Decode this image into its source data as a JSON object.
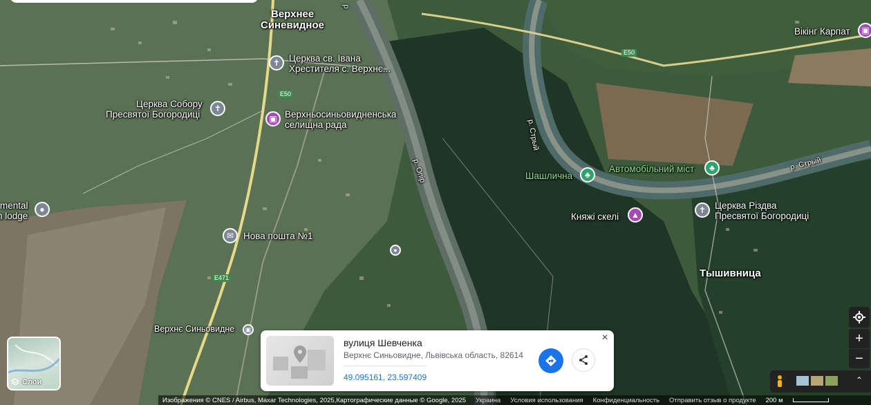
{
  "labels": {
    "town1_line1": "Верхнее",
    "town1_line2": "Синевидное",
    "church_ivan_line1": "Церква св. Івана",
    "church_ivan_line2": "Хрестителя с. Верхнє...",
    "church_sobor_line1": "Церква Собору",
    "church_sobor_line2": "Пресвятої Богородиці",
    "council_line1": "Верхньосиньовидненська",
    "council_line2": "селищна рада",
    "mental_line1": "mental",
    "mental_line2": "n lodge",
    "nova_poshta": "Нова пошта №1",
    "station": "Верхнє Синьовидне",
    "shashlychna": "Шашлична",
    "auto_bridge": "Автомобільний міст",
    "kniazhi": "Княжі скелі",
    "church_rizdva_line1": "Церква Різдва",
    "church_rizdva_line2": "Пресвятої Богородиці",
    "tyshivnytsia": "Тышивница",
    "viking": "Вікінг Карпат",
    "river_opir": "р. Опір",
    "river_stryi1": "р. Стрый",
    "river_stryi2": "р. Стрый",
    "river_top": "р"
  },
  "roads": {
    "e50_a": "E50",
    "e50_b": "E50",
    "e471": "E471"
  },
  "card": {
    "title": "вулиця Шевченка",
    "address": "Верхнє Синьовидне, Львівська область, 82614",
    "coords": "49.095161, 23.597409",
    "close": "×"
  },
  "layers": {
    "label": "Слои"
  },
  "footer": {
    "imagery": "Изображения © CNES / Airbus, Maxar Technologies, 2025,Картографические данные © Google, 2025",
    "country": "Украина",
    "terms": "Условия использования",
    "privacy": "Конфиденциальность",
    "feedback": "Отправить отзыв о продукте",
    "scale": "200 м"
  },
  "colors": {
    "accent": "#1a73e8",
    "church_pin": "#7b8893",
    "purple_pin": "#a64ab7",
    "green_pin": "#2ea36d"
  }
}
